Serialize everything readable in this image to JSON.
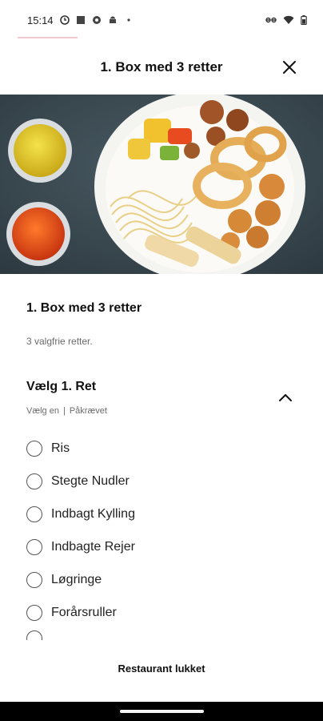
{
  "status_bar": {
    "time": "15:14",
    "left_icons": [
      "clock-icon",
      "app-square-icon",
      "gear-icon",
      "android-icon",
      "dot-icon"
    ],
    "right_icons": [
      "link-icon",
      "wifi-icon",
      "battery-icon"
    ]
  },
  "header": {
    "title": "1. Box med 3 retter"
  },
  "item": {
    "title": "1. Box med 3 retter",
    "description": "3 valgfrie retter."
  },
  "group": {
    "title": "Vælg 1. Ret",
    "hint": "Vælg en",
    "required": "Påkrævet",
    "options": [
      {
        "label": "Ris"
      },
      {
        "label": "Stegte Nudler"
      },
      {
        "label": "Indbagt Kylling"
      },
      {
        "label": "Indbagte Rejer"
      },
      {
        "label": "Løgringe"
      },
      {
        "label": "Forårsruller"
      }
    ]
  },
  "footer": {
    "status": "Restaurant lukket"
  }
}
